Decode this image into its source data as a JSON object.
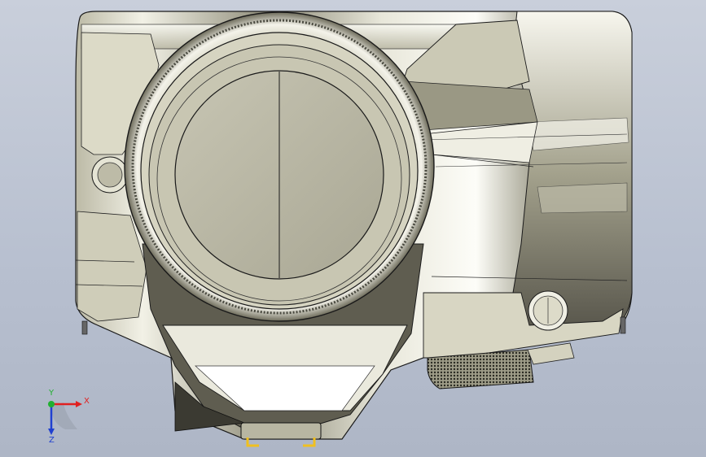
{
  "viewport": {
    "background_top": "#c9cfdb",
    "background_bottom": "#aeb6c6",
    "model_base_color": "#d9d7c4",
    "model_shadow_color": "#7d7b68",
    "edge_color": "#1a1a1a"
  },
  "triad": {
    "x_label": "X",
    "y_label": "Y",
    "z_label": "Z",
    "x_color": "#e02020",
    "y_color": "#20b030",
    "z_color": "#2040d0"
  }
}
